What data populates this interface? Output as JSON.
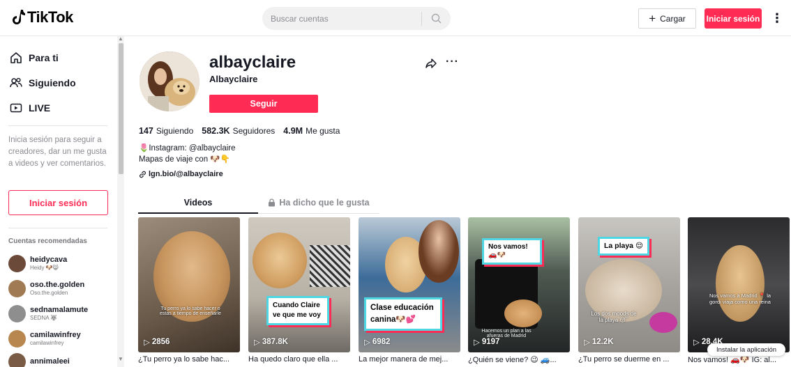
{
  "header": {
    "logo_text": "TikTok",
    "search_placeholder": "Buscar cuentas",
    "upload_label": "Cargar",
    "login_label": "Iniciar sesión"
  },
  "sidebar": {
    "nav": [
      {
        "label": "Para ti",
        "icon": "home-icon"
      },
      {
        "label": "Siguiendo",
        "icon": "following-icon"
      },
      {
        "label": "LIVE",
        "icon": "live-icon"
      }
    ],
    "login_prompt": "Inicia sesión para seguir a creadores, dar un me gusta a videos y ver comentarios.",
    "login_button": "Iniciar sesión",
    "recommended_title": "Cuentas recomendadas",
    "accounts": [
      {
        "name": "heidycava",
        "sub": "Heidy 🐶😸",
        "color": "#6b4a3a"
      },
      {
        "name": "oso.the.golden",
        "sub": "Oso.the.golden",
        "color": "#a07a52"
      },
      {
        "name": "sednamalamute",
        "sub": "SEDNA 🐺",
        "color": "#8e8e8e"
      },
      {
        "name": "camilawinfrey",
        "sub": "camilawinfrey",
        "color": "#b8874f"
      },
      {
        "name": "annimaleei",
        "sub": "",
        "color": "#7a5b46"
      }
    ]
  },
  "profile": {
    "username": "albayclaire",
    "nickname": "Albayclaire",
    "follow_label": "Seguir",
    "following_count": "147",
    "following_label": "Siguiendo",
    "followers_count": "582.3K",
    "followers_label": "Seguidores",
    "likes_count": "4.9M",
    "likes_label": "Me gusta",
    "bio_line1": "🌷Instagram: @albayclaire",
    "bio_line2": "Mapas de viaje con 🐶👇",
    "bio_link": "lgn.bio/@albayclaire"
  },
  "tabs": {
    "videos": "Videos",
    "liked": "Ha dicho que le gusta"
  },
  "videos": [
    {
      "views": "2856",
      "desc": "¿Tu perro ya lo sabe hac...",
      "caption": "",
      "overlay": "Tu perro ya lo sabe hacer o estas a tiempo de enseñarle"
    },
    {
      "views": "387.8K",
      "desc": "Ha quedo claro que ella ...",
      "caption": "Cuando Claire ve que me voy",
      "overlay": ""
    },
    {
      "views": "6982",
      "desc": "La mejor manera de mej...",
      "caption": "Clase educación canina🐶💕",
      "overlay": ""
    },
    {
      "views": "9197",
      "desc": "¿Quién se viene? 😉 🚙...",
      "caption": "Nos vamos! 🚗🐶",
      "overlay": "Hacemos un plan a las afueras de Madrid"
    },
    {
      "views": "12.2K",
      "desc": "¿Tu perro se duerme en ...",
      "caption": "La playa 😌",
      "overlay": "Los dos moods de la playa 😴"
    },
    {
      "views": "28.4K",
      "desc": "Nos vamos! 🚗🐶 IG: al...",
      "caption": "",
      "overlay": "Nos vamos a Madrid 📍 la gordi viaja como una reina"
    }
  ],
  "install_app": "Instalar la aplicación",
  "colors": {
    "accent": "#fe2c55",
    "text": "#161823",
    "muted": "#8a8b91"
  }
}
